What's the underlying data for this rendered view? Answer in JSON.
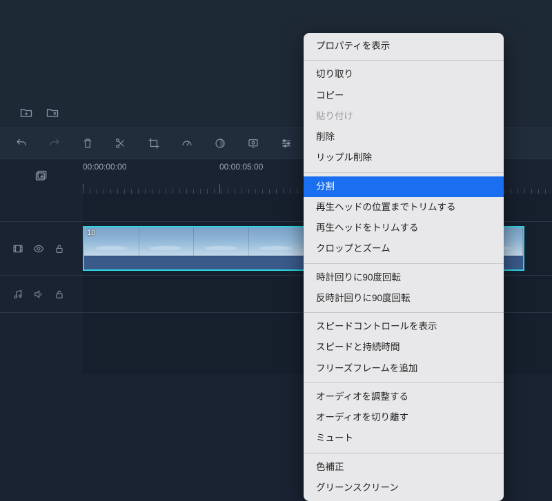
{
  "timecodes": {
    "tc0": "00:00:00:00",
    "tc5": "00:00:05:00"
  },
  "clip": {
    "label": "18"
  },
  "menu": {
    "show_properties": "プロパティを表示",
    "cut": "切り取り",
    "copy": "コピー",
    "paste": "貼り付け",
    "delete": "削除",
    "ripple_delete": "リップル削除",
    "split": "分割",
    "trim_to_playhead": "再生ヘッドの位置までトリムする",
    "trim_playhead": "再生ヘッドをトリムする",
    "crop_zoom": "クロップとズーム",
    "rotate_cw": "時計回りに90度回転",
    "rotate_ccw": "反時計回りに90度回転",
    "show_speed": "スピードコントロールを表示",
    "speed_duration": "スピードと持続時間",
    "freeze_frame": "フリーズフレームを追加",
    "adjust_audio": "オーディオを調整する",
    "detach_audio": "オーディオを切り離す",
    "mute": "ミュート",
    "color_correction": "色補正",
    "green_screen": "グリーンスクリーン"
  }
}
